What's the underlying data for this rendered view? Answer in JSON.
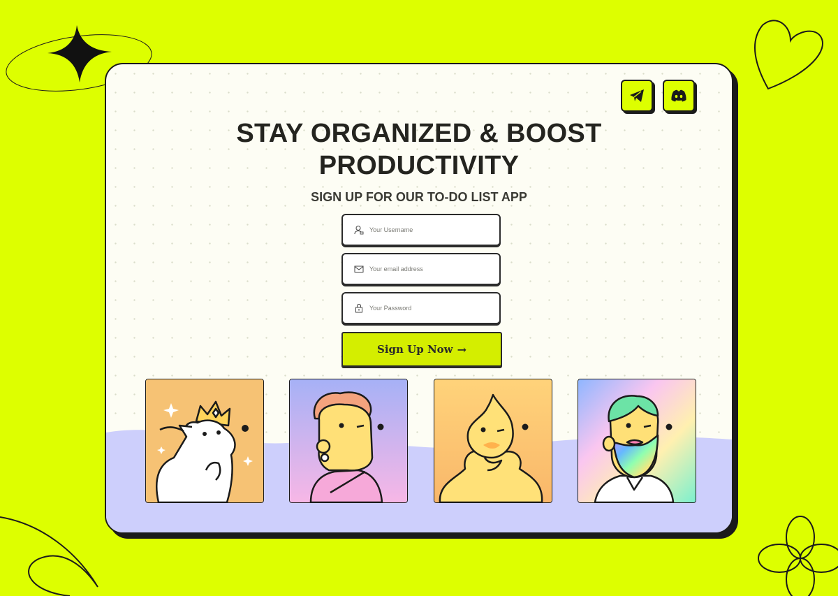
{
  "hero": {
    "title_line1": "STAY ORGANIZED & BOOST",
    "title_line2": "PRODUCTIVITY",
    "subtitle": "SIGN UP FOR OUR TO-DO LIST APP"
  },
  "social": [
    {
      "icon": "telegram-icon"
    },
    {
      "icon": "discord-icon"
    }
  ],
  "form": {
    "username": {
      "placeholder": "Your Username",
      "value": "",
      "icon": "user-icon"
    },
    "email": {
      "placeholder": "Your email address",
      "value": "",
      "icon": "mail-icon"
    },
    "password": {
      "placeholder": "Your Password",
      "value": "",
      "icon": "lock-icon"
    },
    "submit_label": "Sign Up Now",
    "submit_arrow": "→"
  },
  "avatars": [
    {
      "name": "cat-king-avatar"
    },
    {
      "name": "curly-hair-avatar"
    },
    {
      "name": "flame-avatar"
    },
    {
      "name": "rainbow-beard-avatar"
    }
  ],
  "colors": {
    "background": "#ddff00",
    "card": "#fdfdf4",
    "wave": "#cdcffc",
    "outline": "#1b1b1b",
    "button": "#d4ee00"
  }
}
